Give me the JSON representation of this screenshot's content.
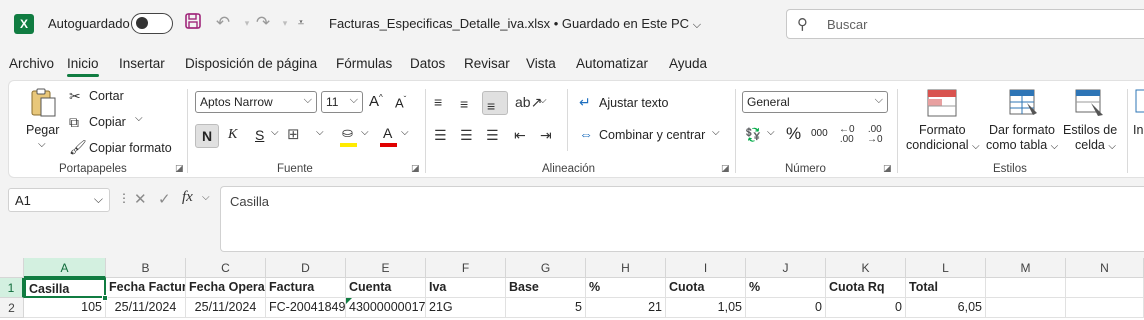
{
  "title_bar": {
    "autosave_label": "Autoguardado",
    "filename": "Facturas_Especificas_Detalle_iva.xlsx • Guardado en Este PC",
    "search_placeholder": "Buscar"
  },
  "menu": {
    "tabs": [
      "Archivo",
      "Inicio",
      "Insertar",
      "Disposición de página",
      "Fórmulas",
      "Datos",
      "Revisar",
      "Vista",
      "Automatizar",
      "Ayuda"
    ],
    "active": "Inicio"
  },
  "ribbon": {
    "clipboard": {
      "paste": "Pegar",
      "cut": "Cortar",
      "copy": "Copiar",
      "format_painter": "Copiar formato",
      "label": "Portapapeles"
    },
    "font": {
      "name": "Aptos Narrow",
      "size": "11",
      "bold": "N",
      "italic": "K",
      "underline": "S",
      "label": "Fuente"
    },
    "alignment": {
      "wrap": "Ajustar texto",
      "merge": "Combinar y centrar",
      "label": "Alineación"
    },
    "number": {
      "format": "General",
      "percent": "%",
      "thousands": "000",
      "label": "Número"
    },
    "styles": {
      "conditional_line1": "Formato",
      "conditional_line2": "condicional",
      "table_line1": "Dar formato",
      "table_line2": "como tabla",
      "cell_line1": "Estilos de",
      "cell_line2": "celda",
      "insert_partial": "In",
      "label": "Estilos"
    }
  },
  "formula_bar": {
    "name_box": "A1",
    "fx": "fx",
    "content": "Casilla"
  },
  "grid": {
    "columns": [
      "A",
      "B",
      "C",
      "D",
      "E",
      "F",
      "G",
      "H",
      "I",
      "J",
      "K",
      "L",
      "M",
      "N"
    ],
    "rows": [
      "1",
      "2"
    ],
    "row1": [
      "Casilla",
      "Fecha Factur",
      "Fecha Opera",
      "Factura",
      "Cuenta",
      "Iva",
      "Base",
      "%",
      "Cuota",
      "%",
      "Cuota Rq",
      "Total",
      "",
      ""
    ],
    "row2": [
      "105",
      "25/11/2024",
      "25/11/2024",
      "FC-20041849",
      "43000000017",
      "21G",
      "5",
      "21",
      "1,05",
      "0",
      "0",
      "6,05",
      "",
      ""
    ]
  },
  "colors": {
    "accent": "#107c41"
  }
}
